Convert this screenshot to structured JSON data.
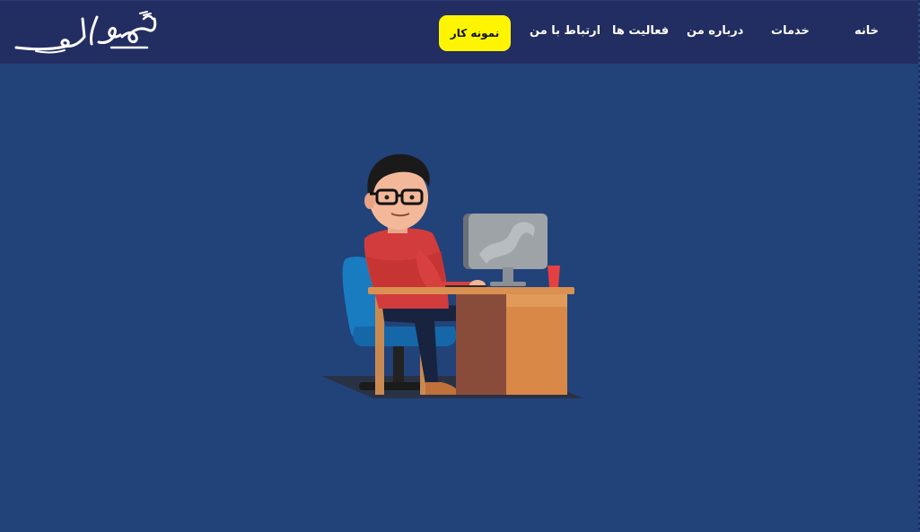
{
  "header": {
    "logo_text": "محمّد امرالهی",
    "nav": {
      "home": "خانه",
      "services": "خدمات",
      "about": "درباره من",
      "activities": "فعالیت ها",
      "contact": "ارتباط با من"
    },
    "cta_label": "نمونه کار"
  },
  "hero": {
    "illustration": "developer-at-desk-illustration"
  },
  "colors": {
    "page_background": "#22427a",
    "navbar_background": "#222d62",
    "cta_background": "#fff500",
    "nav_text": "#ffffff"
  }
}
